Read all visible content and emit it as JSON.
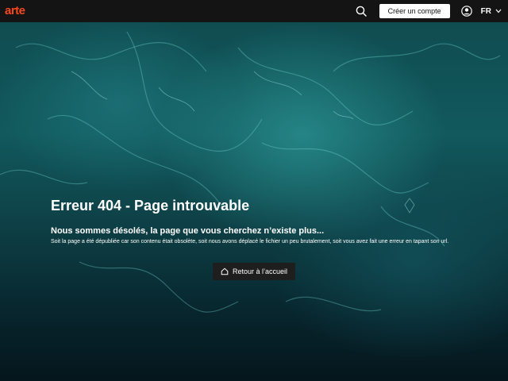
{
  "header": {
    "logo": "arte",
    "create_account_label": "Créer un compte",
    "language": "FR"
  },
  "main": {
    "title": "Erreur 404 - Page introuvable",
    "subtitle": "Nous sommes désolés, la page que vous cherchez n’existe plus...",
    "description": "Soit la page a été dépubliée car son contenu était obsolète, soit nous avons déplacé le fichier un peu brutalement, soit vous avez fait une erreur en tapant son url.",
    "home_button_label": "Retour à l’accueil"
  },
  "icons": {
    "search": "search-icon",
    "user": "user-icon",
    "language_dropdown": "chevron-down-icon",
    "home": "home-icon"
  },
  "colors": {
    "brand": "#fa481c",
    "header_bg": "#141414",
    "button_dark": "#1e1e1e"
  }
}
